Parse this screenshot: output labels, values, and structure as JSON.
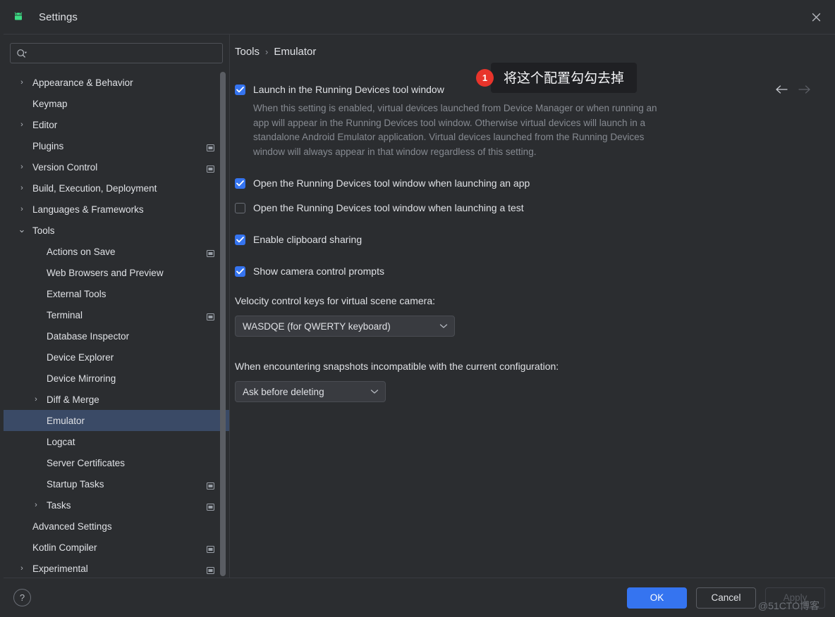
{
  "window": {
    "title": "Settings",
    "app_icon": "android-logo-icon",
    "close_icon": "close-icon"
  },
  "sidebar": {
    "search": {
      "placeholder": "",
      "value": "",
      "icon": "search-icon",
      "dropdown_icon": "chevron-down-icon"
    },
    "items": [
      {
        "label": "Appearance & Behavior",
        "level": 0,
        "arrow": "collapsed",
        "modified": false,
        "selected": false
      },
      {
        "label": "Keymap",
        "level": 0,
        "arrow": "none",
        "modified": false,
        "selected": false
      },
      {
        "label": "Editor",
        "level": 0,
        "arrow": "collapsed",
        "modified": false,
        "selected": false
      },
      {
        "label": "Plugins",
        "level": 0,
        "arrow": "none",
        "modified": true,
        "selected": false
      },
      {
        "label": "Version Control",
        "level": 0,
        "arrow": "collapsed",
        "modified": true,
        "selected": false
      },
      {
        "label": "Build, Execution, Deployment",
        "level": 0,
        "arrow": "collapsed",
        "modified": false,
        "selected": false
      },
      {
        "label": "Languages & Frameworks",
        "level": 0,
        "arrow": "collapsed",
        "modified": false,
        "selected": false
      },
      {
        "label": "Tools",
        "level": 0,
        "arrow": "expanded",
        "modified": false,
        "selected": false
      },
      {
        "label": "Actions on Save",
        "level": 1,
        "arrow": "none",
        "modified": true,
        "selected": false
      },
      {
        "label": "Web Browsers and Preview",
        "level": 1,
        "arrow": "none",
        "modified": false,
        "selected": false
      },
      {
        "label": "External Tools",
        "level": 1,
        "arrow": "none",
        "modified": false,
        "selected": false
      },
      {
        "label": "Terminal",
        "level": 1,
        "arrow": "none",
        "modified": true,
        "selected": false
      },
      {
        "label": "Database Inspector",
        "level": 1,
        "arrow": "none",
        "modified": false,
        "selected": false
      },
      {
        "label": "Device Explorer",
        "level": 1,
        "arrow": "none",
        "modified": false,
        "selected": false
      },
      {
        "label": "Device Mirroring",
        "level": 1,
        "arrow": "none",
        "modified": false,
        "selected": false
      },
      {
        "label": "Diff & Merge",
        "level": 1,
        "arrow": "collapsed",
        "modified": false,
        "selected": false
      },
      {
        "label": "Emulator",
        "level": 1,
        "arrow": "none",
        "modified": false,
        "selected": true
      },
      {
        "label": "Logcat",
        "level": 1,
        "arrow": "none",
        "modified": false,
        "selected": false
      },
      {
        "label": "Server Certificates",
        "level": 1,
        "arrow": "none",
        "modified": false,
        "selected": false
      },
      {
        "label": "Startup Tasks",
        "level": 1,
        "arrow": "none",
        "modified": true,
        "selected": false
      },
      {
        "label": "Tasks",
        "level": 1,
        "arrow": "collapsed",
        "modified": true,
        "selected": false
      },
      {
        "label": "Advanced Settings",
        "level": 0,
        "arrow": "none",
        "modified": false,
        "selected": false
      },
      {
        "label": "Kotlin Compiler",
        "level": 0,
        "arrow": "none",
        "modified": true,
        "selected": false
      },
      {
        "label": "Experimental",
        "level": 0,
        "arrow": "collapsed",
        "modified": true,
        "selected": false
      }
    ]
  },
  "content": {
    "breadcrumb": {
      "parent": "Tools",
      "separator": "›",
      "current": "Emulator"
    },
    "nav": {
      "back_icon": "arrow-left-icon",
      "forward_icon": "arrow-right-icon"
    },
    "checkboxes": [
      {
        "label": "Launch in the Running Devices tool window",
        "checked": true
      },
      {
        "label": "Open the Running Devices tool window when launching an app",
        "checked": true
      },
      {
        "label": "Open the Running Devices tool window when launching a test",
        "checked": false
      },
      {
        "label": "Enable clipboard sharing",
        "checked": true
      },
      {
        "label": "Show camera control prompts",
        "checked": true
      }
    ],
    "description": "When this setting is enabled, virtual devices launched from Device Manager or when running an app will appear in the Running Devices tool window. Otherwise virtual devices will launch in a standalone Android Emulator application. Virtual devices launched from the Running Devices window will always appear in that window regardless of this setting.",
    "velocity": {
      "label": "Velocity control keys for virtual scene camera:",
      "value": "WASDQE (for QWERTY keyboard)",
      "chevron_icon": "chevron-down-icon"
    },
    "snapshots": {
      "label": "When encountering snapshots incompatible with the current configuration:",
      "value": "Ask before deleting",
      "chevron_icon": "chevron-down-icon"
    }
  },
  "annotation": {
    "badge": "1",
    "text": "将这个配置勾勾去掉",
    "badge_color": "#e8342b"
  },
  "footer": {
    "help_label": "?",
    "ok_label": "OK",
    "cancel_label": "Cancel",
    "apply_label": "Apply",
    "apply_disabled": true,
    "accent_color": "#3574f0"
  },
  "watermark": "@51CTO博客"
}
